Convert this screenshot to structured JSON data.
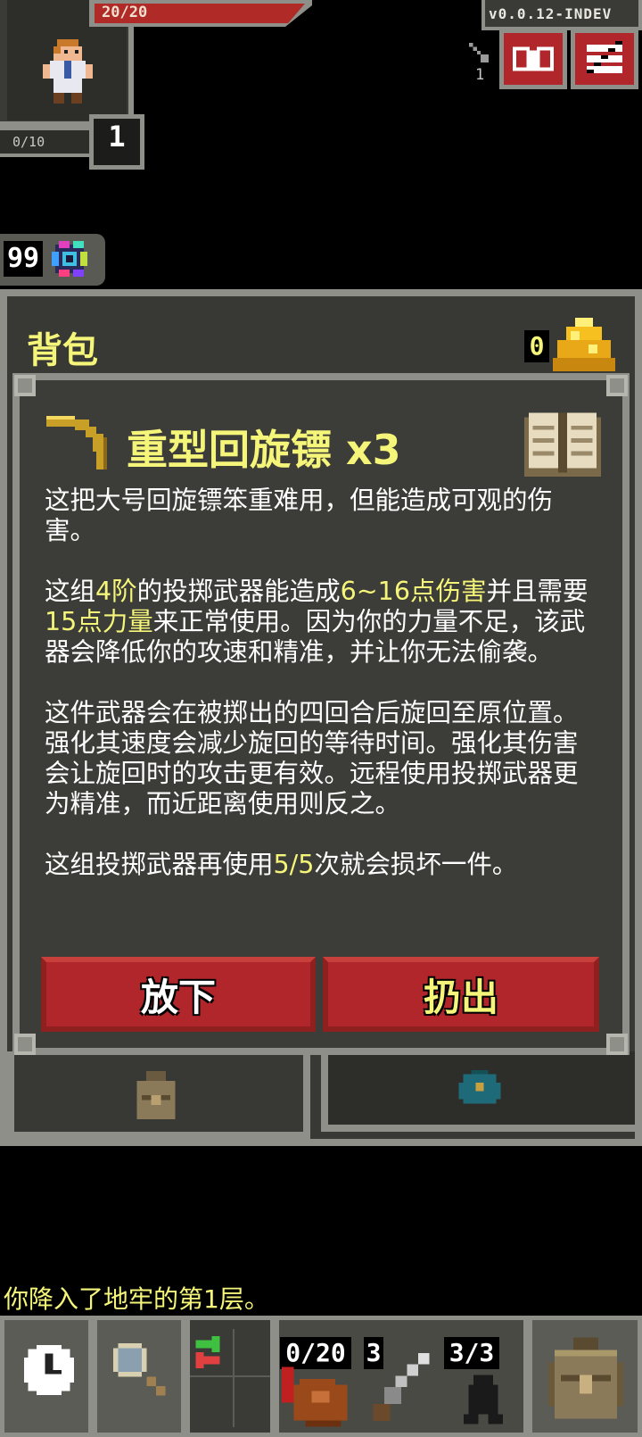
{
  "status": {
    "hp_text": "20/20",
    "hp_fraction": 1.0,
    "exp_text": "0/10",
    "level": "1",
    "version": "v0.0.12-INDEV",
    "depth": "1"
  },
  "resource": {
    "count": "99"
  },
  "bag": {
    "title": "背包",
    "gold": "0"
  },
  "item": {
    "title": "重型回旋镖 x3",
    "desc_p1": "这把大号回旋镖笨重难用，但能造成可观的伤害。",
    "desc_p2": {
      "t1": "这组",
      "tier": "4阶",
      "t2": "的投掷武器能造成",
      "damage": "6~16点伤害",
      "t3": "并且需要",
      "strength": "15点力量",
      "t4": "来正常使用。因为你的力量不足，该武器会降低你的攻速和精准，并让你无法偷袭。"
    },
    "desc_p3": "这件武器会在被掷出的四回合后旋回至原位置。强化其速度会减少旋回的等待时间。强化其伤害会让旋回时的攻击更有效。远程使用投掷武器更为精准，而近距离使用则反之。",
    "desc_p4": {
      "t1": "这组投掷武器再使用",
      "uses": "5/5",
      "t2": "次就会损坏一件。"
    },
    "drop_label": "放下",
    "throw_label": "扔出"
  },
  "log": {
    "message": "你降入了地牢的第1层。"
  },
  "toolbar": {
    "quickslot1": "0/20",
    "quickslot2": "3",
    "quickslot3": "3/3"
  },
  "colors": {
    "highlight": "#f5f57a",
    "button_red": "#b1262a",
    "frame": "#8e8f88",
    "panel": "#3c3c38"
  }
}
